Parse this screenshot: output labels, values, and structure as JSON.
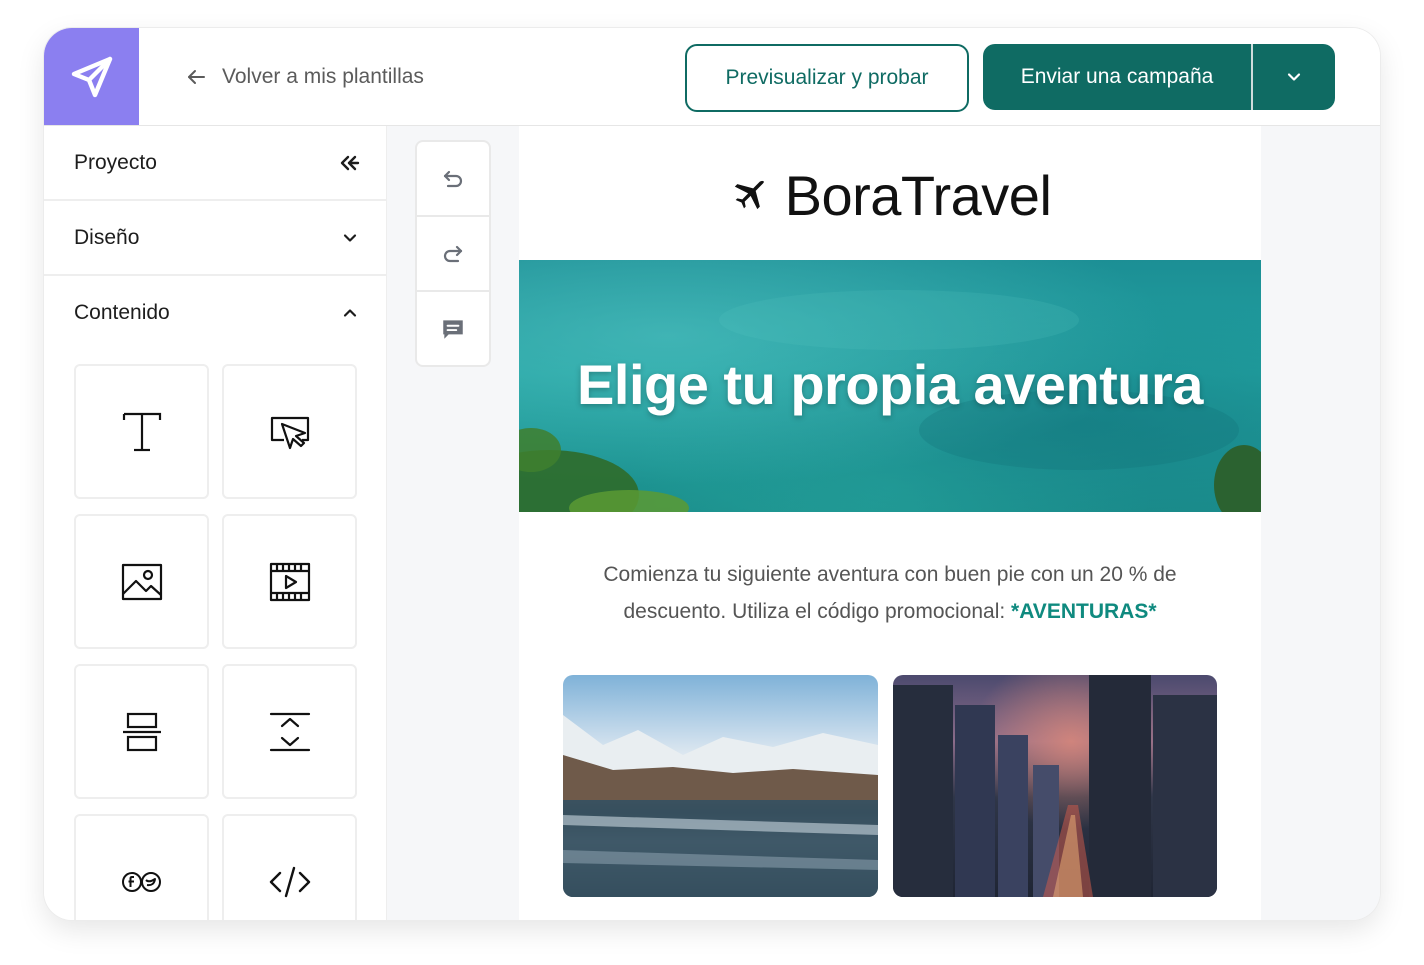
{
  "topbar": {
    "back_label": "Volver a mis plantillas",
    "preview_label": "Previsualizar y probar",
    "send_label": "Enviar una campaña"
  },
  "sidebar": {
    "sections": [
      {
        "label": "Proyecto",
        "icon": "double-chevron-left-icon"
      },
      {
        "label": "Diseño",
        "icon": "chevron-down-icon"
      },
      {
        "label": "Contenido",
        "icon": "chevron-up-icon"
      }
    ],
    "blocks": [
      {
        "icon": "text-block-icon"
      },
      {
        "icon": "button-block-icon"
      },
      {
        "icon": "image-block-icon"
      },
      {
        "icon": "video-block-icon"
      },
      {
        "icon": "divider-block-icon"
      },
      {
        "icon": "spacer-block-icon"
      },
      {
        "icon": "social-block-icon"
      },
      {
        "icon": "html-block-icon"
      }
    ]
  },
  "tools": [
    {
      "icon": "undo-icon"
    },
    {
      "icon": "redo-icon"
    },
    {
      "icon": "comment-icon"
    }
  ],
  "email": {
    "brand_name": "BoraTravel",
    "hero_title": "Elige tu propia aventura",
    "promo_text": "Comienza tu siguiente aventura con buen pie con un 20 % de descuento. Utiliza el código promocional: ",
    "promo_code": "*AVENTURAS*"
  },
  "colors": {
    "accent": "#8b7ff0",
    "primary": "#0f6b63",
    "promo_code": "#0f8a7f"
  }
}
